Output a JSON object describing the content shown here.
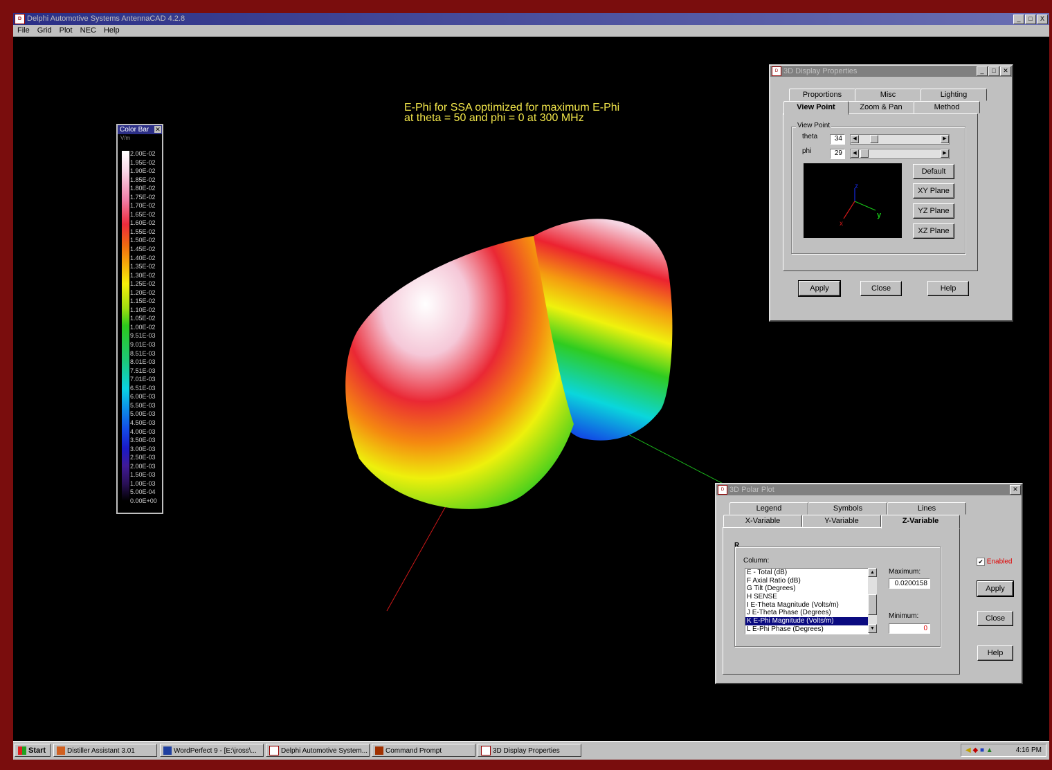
{
  "app": {
    "title": "Delphi Automotive Systems AntennaCAD 4.2.8",
    "menu": [
      "File",
      "Grid",
      "Plot",
      "NEC",
      "Help"
    ],
    "window_buttons": [
      "_",
      "□",
      "X"
    ]
  },
  "plot": {
    "title_line1": "E-Phi for SSA optimized for maximum E-Phi",
    "title_line2": "at theta = 50 and phi = 0 at 300 MHz"
  },
  "colorbar": {
    "title": "Color Bar",
    "unit": "V/m",
    "labels": [
      "2.00E-02",
      "1.95E-02",
      "1.90E-02",
      "1.85E-02",
      "1.80E-02",
      "1.75E-02",
      "1.70E-02",
      "1.65E-02",
      "1.60E-02",
      "1.55E-02",
      "1.50E-02",
      "1.45E-02",
      "1.40E-02",
      "1.35E-02",
      "1.30E-02",
      "1.25E-02",
      "1.20E-02",
      "1.15E-02",
      "1.10E-02",
      "1.05E-02",
      "1.00E-02",
      "9.51E-03",
      "9.01E-03",
      "8.51E-03",
      "8.01E-03",
      "7.51E-03",
      "7.01E-03",
      "6.51E-03",
      "6.00E-03",
      "5.50E-03",
      "5.00E-03",
      "4.50E-03",
      "4.00E-03",
      "3.50E-03",
      "3.00E-03",
      "2.50E-03",
      "2.00E-03",
      "1.50E-03",
      "1.00E-03",
      "5.00E-04",
      "0.00E+00"
    ]
  },
  "display_props": {
    "title": "3D Display Properties",
    "tabs_back": [
      "Proportions",
      "Misc",
      "Lighting"
    ],
    "tabs_front": [
      "View Point",
      "Zoom & Pan",
      "Method"
    ],
    "group_label": "View Point",
    "theta_label": "theta",
    "theta_value": "34",
    "phi_label": "phi",
    "phi_value": "29",
    "buttons": [
      "Default",
      "XY Plane",
      "YZ Plane",
      "XZ Plane"
    ],
    "axis_labels": {
      "x": "x",
      "y": "y",
      "z": "z"
    },
    "footer_buttons": [
      "Apply",
      "Close",
      "Help"
    ]
  },
  "polar_plot": {
    "title": "3D Polar Plot",
    "tabs_back": [
      "Legend",
      "Symbols",
      "Lines"
    ],
    "tabs_front": [
      "X-Variable",
      "Y-Variable",
      "Z-Variable"
    ],
    "group_label": "R",
    "column_label": "Column:",
    "columns": [
      "E - Total (dB)",
      "F Axial Ratio (dB)",
      "G Tilt (Degrees)",
      "H SENSE",
      "I E-Theta Magnitude (Volts/m)",
      "J E-Theta Phase (Degrees)",
      "K E-Phi Magnitude (Volts/m)",
      "L E-Phi Phase (Degrees)"
    ],
    "selected_index": 6,
    "max_label": "Maximum:",
    "max_value": "0.0200158",
    "min_label": "Minimum:",
    "min_value": "0",
    "enabled_label": "Enabled",
    "enabled": true,
    "side_buttons": [
      "Apply",
      "Close",
      "Help"
    ]
  },
  "taskbar": {
    "start": "Start",
    "items": [
      "Distiller Assistant 3.01",
      "WordPerfect 9 - [E:\\jross\\...",
      "Delphi Automotive System...",
      "Command Prompt",
      "3D Display Properties"
    ],
    "clock": "4:16 PM"
  },
  "colors": {
    "frame": "#7a0d0d",
    "title_text": "#f2e64a",
    "selection": "#0a0a80"
  }
}
